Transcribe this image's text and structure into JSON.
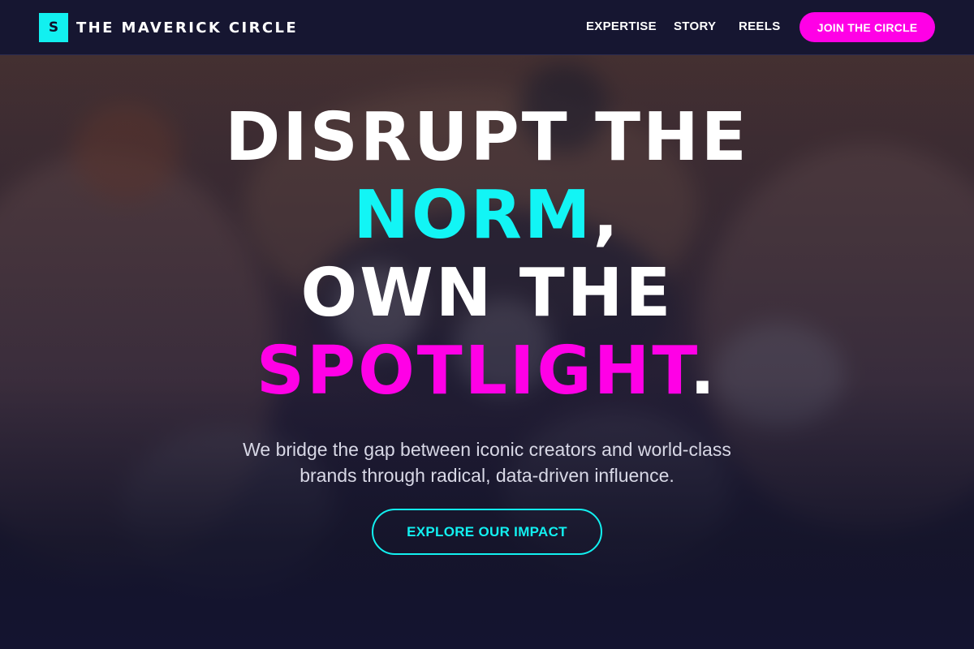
{
  "brand": {
    "logo_letter": "S",
    "name": "THE MAVERICK CIRCLE"
  },
  "nav": {
    "items": [
      {
        "label": "EXPERTISE"
      },
      {
        "label": "STORY"
      },
      {
        "label": "REELS"
      }
    ],
    "cta_label": "JOIN THE CIRCLE"
  },
  "hero": {
    "headline": {
      "line1": "DISRUPT THE",
      "line2_highlight": "NORM",
      "line2_suffix": ",",
      "line3": "OWN THE",
      "line4_highlight": "SPOTLIGHT",
      "line4_suffix": "."
    },
    "subtitle": "We bridge the gap between iconic creators and world-class brands through radical, data-driven influence.",
    "cta_label": "EXPLORE OUR IMPACT",
    "background_image": "blurred-photo-hands-holding-smartphone-over-food"
  },
  "colors": {
    "accent_cyan": "#12f0f0",
    "accent_pink": "#ff00e6",
    "header_bg": "#161631",
    "page_bg": "#141428"
  }
}
